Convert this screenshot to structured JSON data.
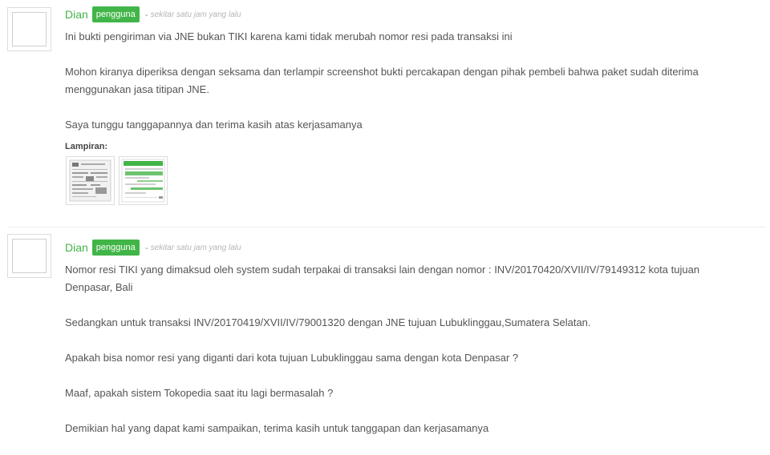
{
  "comments": [
    {
      "author": "Dian",
      "role": "pengguna",
      "separator": "-",
      "time": "sekitar satu jam yang lalu",
      "paragraphs": [
        "Ini bukti pengiriman via JNE bukan TIKI karena kami tidak merubah nomor resi pada transaksi ini",
        "Mohon kiranya diperiksa dengan seksama dan terlampir screenshot bukti percakapan dengan pihak pembeli bahwa paket sudah diterima menggunakan jasa titipan JNE.",
        "Saya tunggu tanggapannya dan terima kasih atas kerjasamanya"
      ],
      "attachments_label": "Lampiran:",
      "attachments": [
        "receipt-image-icon",
        "chat-screenshot-icon"
      ]
    },
    {
      "author": "Dian",
      "role": "pengguna",
      "separator": "-",
      "time": "sekitar satu jam yang lalu",
      "paragraphs": [
        "Nomor resi TIKI yang dimaksud oleh system sudah terpakai di transaksi lain dengan nomor : INV/20170420/XVII/IV/79149312 kota tujuan Denpasar, Bali",
        "Sedangkan untuk transaksi INV/20170419/XVII/IV/79001320 dengan JNE tujuan Lubuklinggau,Sumatera Selatan.",
        "Apakah bisa nomor resi yang diganti dari kota tujuan Lubuklinggau sama dengan kota Denpasar ?",
        "Maaf, apakah sistem Tokopedia saat itu lagi bermasalah ?",
        "Demikian hal yang dapat kami sampaikan, terima kasih untuk tanggapan dan kerjasamanya"
      ]
    }
  ],
  "colors": {
    "accent": "#42b549",
    "text": "#555555",
    "muted": "#b5b5b5"
  }
}
